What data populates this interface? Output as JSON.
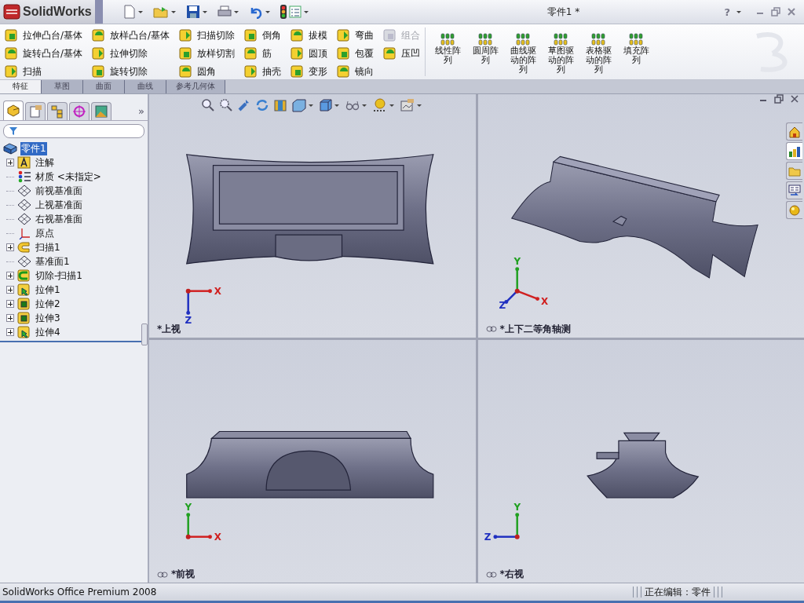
{
  "window": {
    "app_name": "SolidWorks",
    "title": "零件1 *",
    "help": "?"
  },
  "command_manager": {
    "columns": [
      [
        {
          "label": "拉伸凸台/基体",
          "disabled": false
        },
        {
          "label": "旋转凸台/基体",
          "disabled": false
        },
        {
          "label": "扫描",
          "disabled": false
        }
      ],
      [
        {
          "label": "放样凸台/基体",
          "disabled": false
        },
        {
          "label": "拉伸切除",
          "disabled": false
        },
        {
          "label": "旋转切除",
          "disabled": false
        }
      ],
      [
        {
          "label": "扫描切除",
          "disabled": false
        },
        {
          "label": "放样切割",
          "disabled": false
        },
        {
          "label": "圆角",
          "disabled": false
        }
      ],
      [
        {
          "label": "倒角",
          "disabled": false
        },
        {
          "label": "筋",
          "disabled": false
        },
        {
          "label": "抽壳",
          "disabled": false
        }
      ],
      [
        {
          "label": "拔模",
          "disabled": false
        },
        {
          "label": "圆顶",
          "disabled": false
        },
        {
          "label": "变形",
          "disabled": false
        }
      ],
      [
        {
          "label": "弯曲",
          "disabled": false
        },
        {
          "label": "包覆",
          "disabled": false
        },
        {
          "label": "镜向",
          "disabled": false
        }
      ],
      [
        {
          "label": "组合",
          "disabled": true
        },
        {
          "label": "压凹",
          "disabled": false
        }
      ]
    ],
    "patterns": [
      {
        "label": "线性阵列"
      },
      {
        "label": "圆周阵列"
      },
      {
        "label": "曲线驱动的阵列"
      },
      {
        "label": "草图驱动的阵列"
      },
      {
        "label": "表格驱动的阵列"
      },
      {
        "label": "填充阵列"
      }
    ],
    "tabs": [
      {
        "label": "特征",
        "selected": true
      },
      {
        "label": "草图",
        "selected": false
      },
      {
        "label": "曲面",
        "selected": false
      },
      {
        "label": "曲线",
        "selected": false
      },
      {
        "label": "参考几何体",
        "selected": false
      }
    ]
  },
  "feature_manager": {
    "panel_tabs": [
      {
        "selected": true
      },
      {
        "selected": false
      },
      {
        "selected": false
      },
      {
        "selected": false
      },
      {
        "selected": false
      }
    ],
    "more": "»",
    "tree": {
      "label": "零件1",
      "selected": true,
      "children": [
        {
          "label": "注解",
          "kind": "annotation",
          "expandable": true
        },
        {
          "label": "材质 <未指定>",
          "kind": "material",
          "expandable": false
        },
        {
          "label": "前视基准面",
          "kind": "plane",
          "expandable": false
        },
        {
          "label": "上视基准面",
          "kind": "plane",
          "expandable": false
        },
        {
          "label": "右视基准面",
          "kind": "plane",
          "expandable": false
        },
        {
          "label": "原点",
          "kind": "origin",
          "expandable": false
        },
        {
          "label": "扫描1",
          "kind": "sweep",
          "expandable": true
        },
        {
          "label": "基准面1",
          "kind": "plane",
          "expandable": false
        },
        {
          "label": "切除-扫描1",
          "kind": "cut-sweep",
          "expandable": true
        },
        {
          "label": "拉伸1",
          "kind": "extrude",
          "expandable": true
        },
        {
          "label": "拉伸2",
          "kind": "extrude-cut",
          "expandable": true
        },
        {
          "label": "拉伸3",
          "kind": "extrude-cut",
          "expandable": true
        },
        {
          "label": "拉伸4",
          "kind": "extrude",
          "expandable": true
        }
      ]
    }
  },
  "viewports": [
    {
      "label": "*上视",
      "kind": "top",
      "axes": [
        {
          "label": "X",
          "color": "#d02020"
        },
        {
          "label": "Z",
          "color": "#2030c0"
        }
      ]
    },
    {
      "label": "*上下二等角轴测",
      "kind": "iso",
      "axes": [
        {
          "label": "Y",
          "color": "#20a020"
        },
        {
          "label": "Z",
          "color": "#2030c0"
        },
        {
          "label": "X",
          "color": "#d02020"
        }
      ]
    },
    {
      "label": "*前视",
      "kind": "front",
      "axes": [
        {
          "label": "Y",
          "color": "#20a020"
        },
        {
          "label": "X",
          "color": "#d02020"
        }
      ]
    },
    {
      "label": "*右视",
      "kind": "right",
      "axes": [
        {
          "label": "Y",
          "color": "#20a020"
        },
        {
          "label": "Z",
          "color": "#2030c0"
        }
      ]
    }
  ],
  "task_pane": [
    {
      "selected": false
    },
    {
      "selected": true
    },
    {
      "selected": false
    },
    {
      "selected": false
    },
    {
      "selected": false
    }
  ],
  "status_bar": {
    "product": "SolidWorks Office Premium 2008",
    "mode": "正在编辑：零件"
  }
}
